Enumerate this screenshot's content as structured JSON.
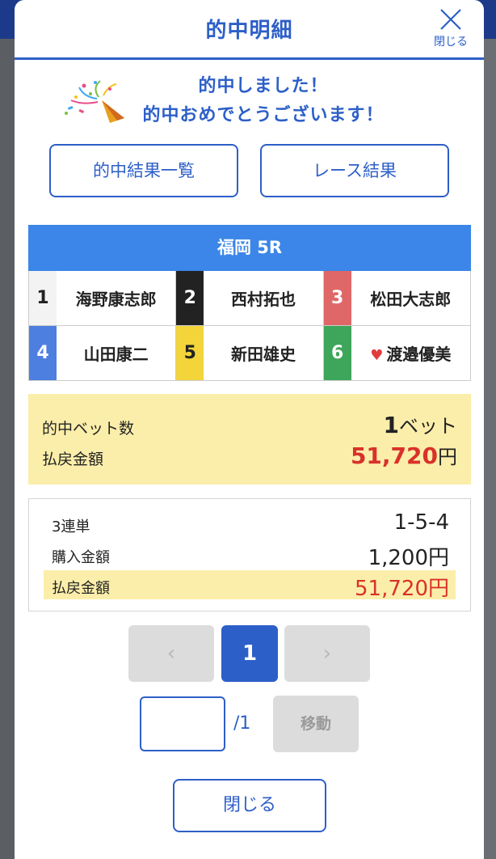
{
  "header": {
    "title": "的中明細",
    "close_label": "閉じる"
  },
  "congrats": {
    "line1": "的中しました！",
    "line2": "的中おめでとうございます！",
    "icon": "party-popper-icon"
  },
  "buttons": {
    "hit_results": "的中結果一覧",
    "race_results": "レース結果"
  },
  "race": {
    "title": "福岡 5R",
    "racers": [
      {
        "num": "1",
        "name": "海野康志郎",
        "bg": "#f3f3f3",
        "fg": "#222222"
      },
      {
        "num": "2",
        "name": "西村拓也",
        "bg": "#222222",
        "fg": "#ffffff"
      },
      {
        "num": "3",
        "name": "松田大志郎",
        "bg": "#e06767",
        "fg": "#ffffff"
      },
      {
        "num": "4",
        "name": "山田康二",
        "bg": "#4c7fe0",
        "fg": "#ffffff"
      },
      {
        "num": "5",
        "name": "新田雄史",
        "bg": "#f3d43a",
        "fg": "#222222"
      },
      {
        "num": "6",
        "name": "渡邉優美",
        "bg": "#3ea65a",
        "fg": "#ffffff",
        "heart": "♥"
      }
    ]
  },
  "summary": {
    "bets_label": "的中ベット数",
    "bets_count": "1",
    "bets_unit": "ベット",
    "payout_label": "払戻金額",
    "payout_value": "51,720",
    "payout_unit": "円"
  },
  "detail": {
    "type_label": "3連単",
    "combination": "1-5-4",
    "purchase_label": "購入金額",
    "purchase_value": "1,200円",
    "payout_label": "払戻金額",
    "payout_value": "51,720円"
  },
  "pagination": {
    "prev": "‹",
    "current": "1",
    "next": "›",
    "input_value": "",
    "total": "/1",
    "move": "移動"
  },
  "footer": {
    "close": "閉じる"
  },
  "colors": {
    "accent": "#2d5fc8",
    "header_bar": "#3b86e8",
    "highlight": "#fbeeaa",
    "payout_red": "#d9312a"
  }
}
